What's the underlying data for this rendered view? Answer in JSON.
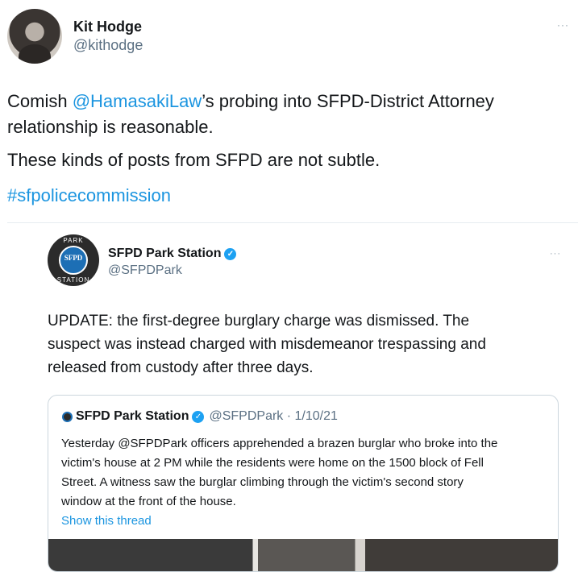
{
  "tweet": {
    "author_name": "Kit Hodge",
    "author_handle": "@kithodge",
    "more": "···",
    "text_line1_pre": "Comish ",
    "text_line1_mention": "@HamasakiLaw",
    "text_line1_post": "’s probing into SFPD-District Attorney",
    "text_line2": "relationship is reasonable.",
    "text_line3": "These kinds of posts from SFPD are not subtle.",
    "hashtag": "#sfpolicecommission"
  },
  "quoted": {
    "author_name": "SFPD Park Station",
    "author_handle": "@SFPDPark",
    "more": "···",
    "avatar_top": "PARK",
    "avatar_center": "SFPD",
    "avatar_bottom": "STATION",
    "text_line1": "UPDATE: the first-degree burglary charge was dismissed. The",
    "text_line2": "suspect was instead charged with misdemeanor trespassing and",
    "text_line3": "released from custody after three days."
  },
  "inner": {
    "author_name": "SFPD Park Station",
    "handle_date": "@SFPDPark · 1/10/21",
    "text_line1": "Yesterday @SFPDPark officers apprehended a brazen burglar who broke into the",
    "text_line2": "victim's house at 2 PM while the residents were home on the 1500 block of Fell",
    "text_line3": "Street. A witness saw the burglar climbing through the victim's second story",
    "text_line4": "window at the front of the house.",
    "show_thread": "Show this thread"
  },
  "icons": {
    "verified": "verified-badge-icon",
    "more": "more-options-icon"
  },
  "colors": {
    "link": "#1b95e0",
    "secondary_text": "#5b7083",
    "verified": "#1da1f2"
  }
}
